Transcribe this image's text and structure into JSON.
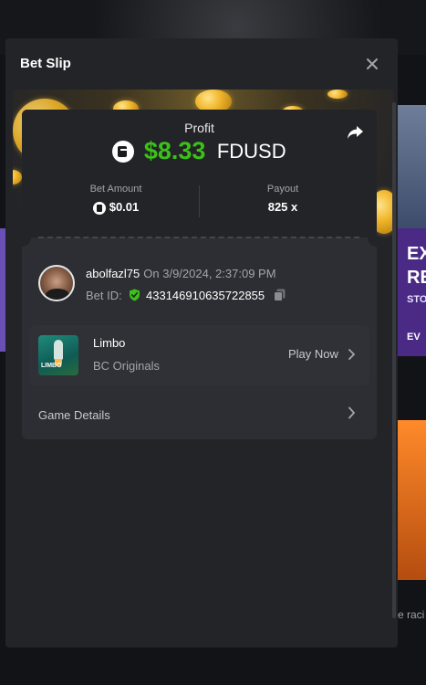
{
  "modal": {
    "title": "Bet Slip"
  },
  "profit": {
    "label": "Profit",
    "amount": "$8.33",
    "currency": "FDUSD",
    "amount_color": "#3bc117"
  },
  "stats": {
    "bet_amount_label": "Bet Amount",
    "bet_amount_value": "$0.01",
    "payout_label": "Payout",
    "payout_value": "825 x"
  },
  "user": {
    "name": "abolfazl75",
    "date_text": "On 3/9/2024, 2:37:09 PM",
    "bet_id_label": "Bet ID:",
    "bet_id": "433146910635722855"
  },
  "game": {
    "name": "Limbo",
    "provider": "BC Originals",
    "play_label": "Play Now",
    "thumb_label": "LIMBO"
  },
  "details": {
    "label": "Game Details"
  },
  "background": {
    "promo_text_1": "EX",
    "promo_text_2": "RE",
    "promo_small": "STO",
    "promo_bottom": "EV",
    "bottom_snippet": "e raci"
  },
  "icons": {
    "close": "close-icon",
    "share": "share-icon",
    "coin": "fdusd-coin-icon",
    "shield": "verified-shield-icon",
    "copy": "copy-icon",
    "chevron": "chevron-right-icon"
  }
}
